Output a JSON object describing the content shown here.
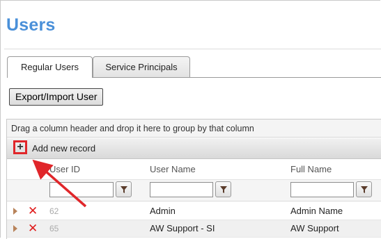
{
  "page": {
    "title": "Users"
  },
  "tabs": [
    {
      "label": "Regular Users",
      "active": true
    },
    {
      "label": "Service Principals",
      "active": false
    }
  ],
  "actions": {
    "export_import_label": "Export/Import User"
  },
  "grid": {
    "group_hint": "Drag a column header and drop it here to group by that column",
    "add_record_label": "Add new record",
    "add_icon": "plus-icon",
    "columns": [
      "User ID",
      "User Name",
      "Full Name"
    ],
    "rows": [
      {
        "user_id": "62",
        "user_name": "Admin",
        "full_name": "Admin Name"
      },
      {
        "user_id": "65",
        "user_name": "AW Support - SI",
        "full_name": "AW Support"
      }
    ]
  },
  "annotation": {
    "highlight_color": "#e0262a",
    "arrow_color": "#e0262a"
  }
}
